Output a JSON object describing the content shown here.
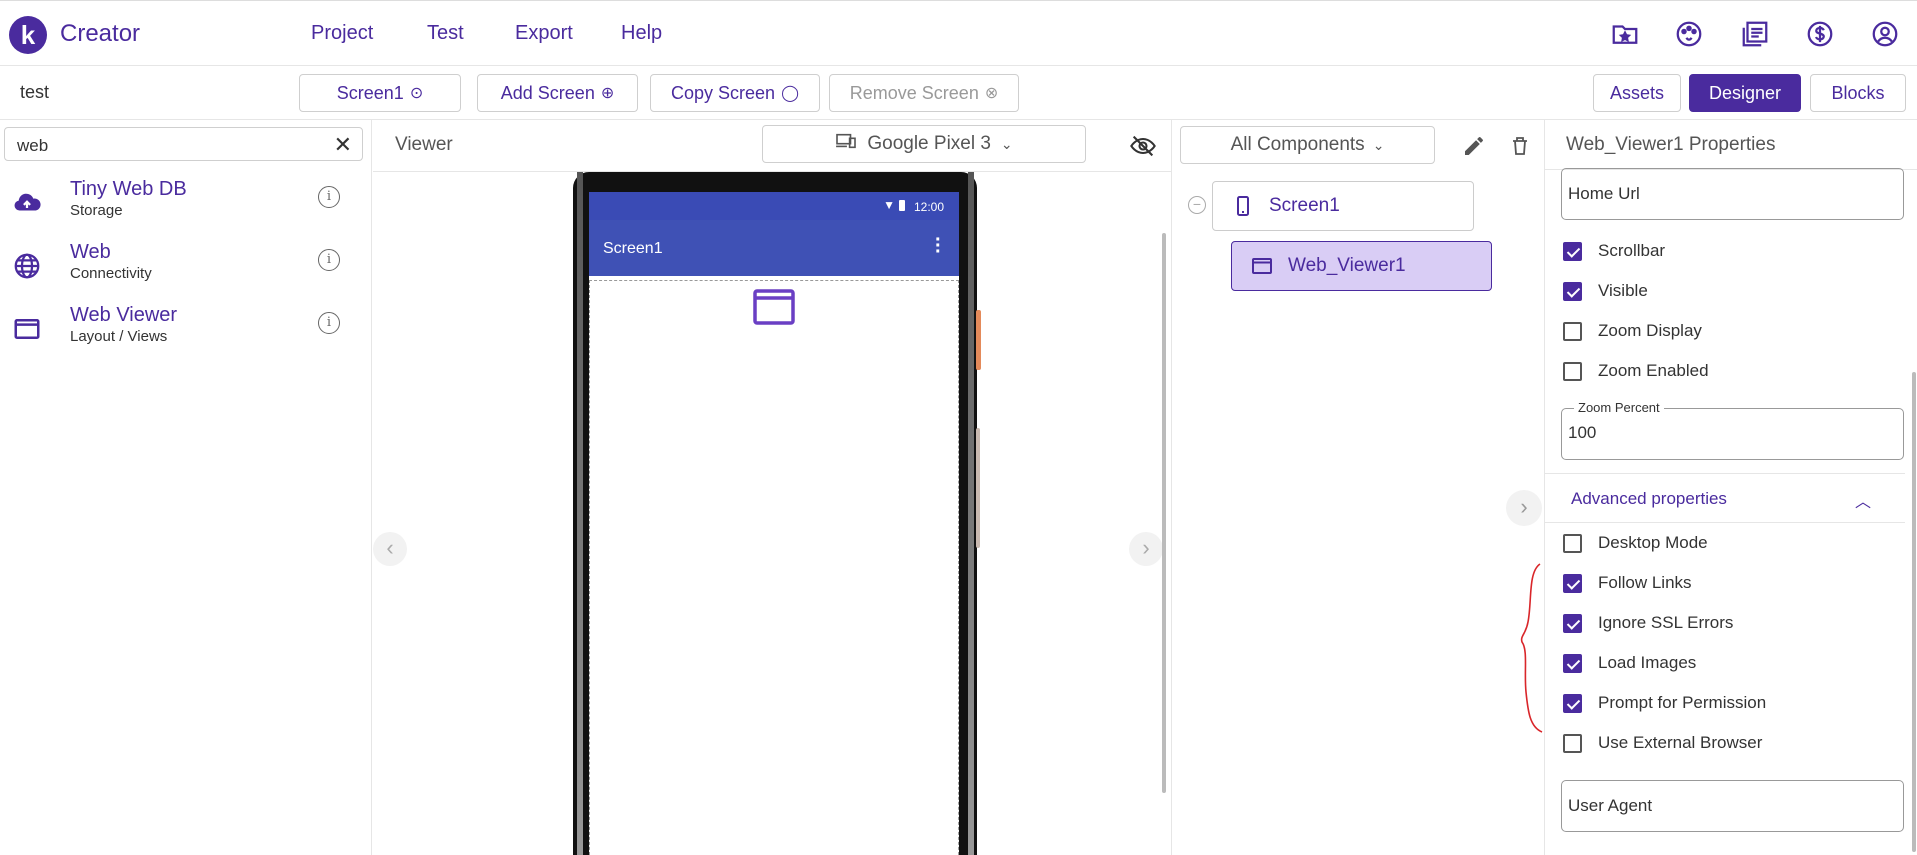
{
  "header": {
    "brand": "Creator",
    "logo_letter": "k",
    "menu": [
      "Project",
      "Test",
      "Export",
      "Help"
    ],
    "icons": [
      "folder-star-icon",
      "palette-icon",
      "gallery-icon",
      "dollar-icon",
      "account-icon"
    ]
  },
  "toolbar": {
    "project_name": "test",
    "screen_select": "Screen1",
    "add_screen": "Add Screen",
    "copy_screen": "Copy Screen",
    "remove_screen": "Remove Screen",
    "assets": "Assets",
    "designer": "Designer",
    "blocks": "Blocks"
  },
  "palette": {
    "search_value": "web",
    "items": [
      {
        "name": "Tiny Web DB",
        "category": "Storage",
        "icon": "cloud-upload-icon"
      },
      {
        "name": "Web",
        "category": "Connectivity",
        "icon": "globe-icon"
      },
      {
        "name": "Web Viewer",
        "category": "Layout / Views",
        "icon": "window-icon"
      }
    ]
  },
  "viewer": {
    "title": "Viewer",
    "device": "Google Pixel 3",
    "status_time": "12:00",
    "screen_title": "Screen1"
  },
  "components": {
    "filter": "All Components",
    "tree": [
      {
        "label": "Screen1",
        "level": 0,
        "selected": false
      },
      {
        "label": "Web_Viewer1",
        "level": 1,
        "selected": true
      }
    ]
  },
  "properties": {
    "title": "Web_Viewer1 Properties",
    "home_url": "Home Url",
    "checkboxes": [
      {
        "label": "Scrollbar",
        "checked": true
      },
      {
        "label": "Visible",
        "checked": true
      },
      {
        "label": "Zoom Display",
        "checked": false
      },
      {
        "label": "Zoom Enabled",
        "checked": false
      }
    ],
    "zoom_percent_label": "Zoom Percent",
    "zoom_percent_value": "100",
    "advanced_label": "Advanced properties",
    "advanced_checkboxes": [
      {
        "label": "Desktop Mode",
        "checked": false
      },
      {
        "label": "Follow Links",
        "checked": true
      },
      {
        "label": "Ignore SSL Errors",
        "checked": true
      },
      {
        "label": "Load Images",
        "checked": true
      },
      {
        "label": "Prompt for Permission",
        "checked": true
      },
      {
        "label": "Use External Browser",
        "checked": false
      }
    ],
    "user_agent": "User Agent"
  },
  "colors": {
    "accent": "#4a2b9e",
    "selected_bg": "#d9cdf5",
    "appbar": "#3f51b5",
    "annotation": "#d9262a"
  }
}
